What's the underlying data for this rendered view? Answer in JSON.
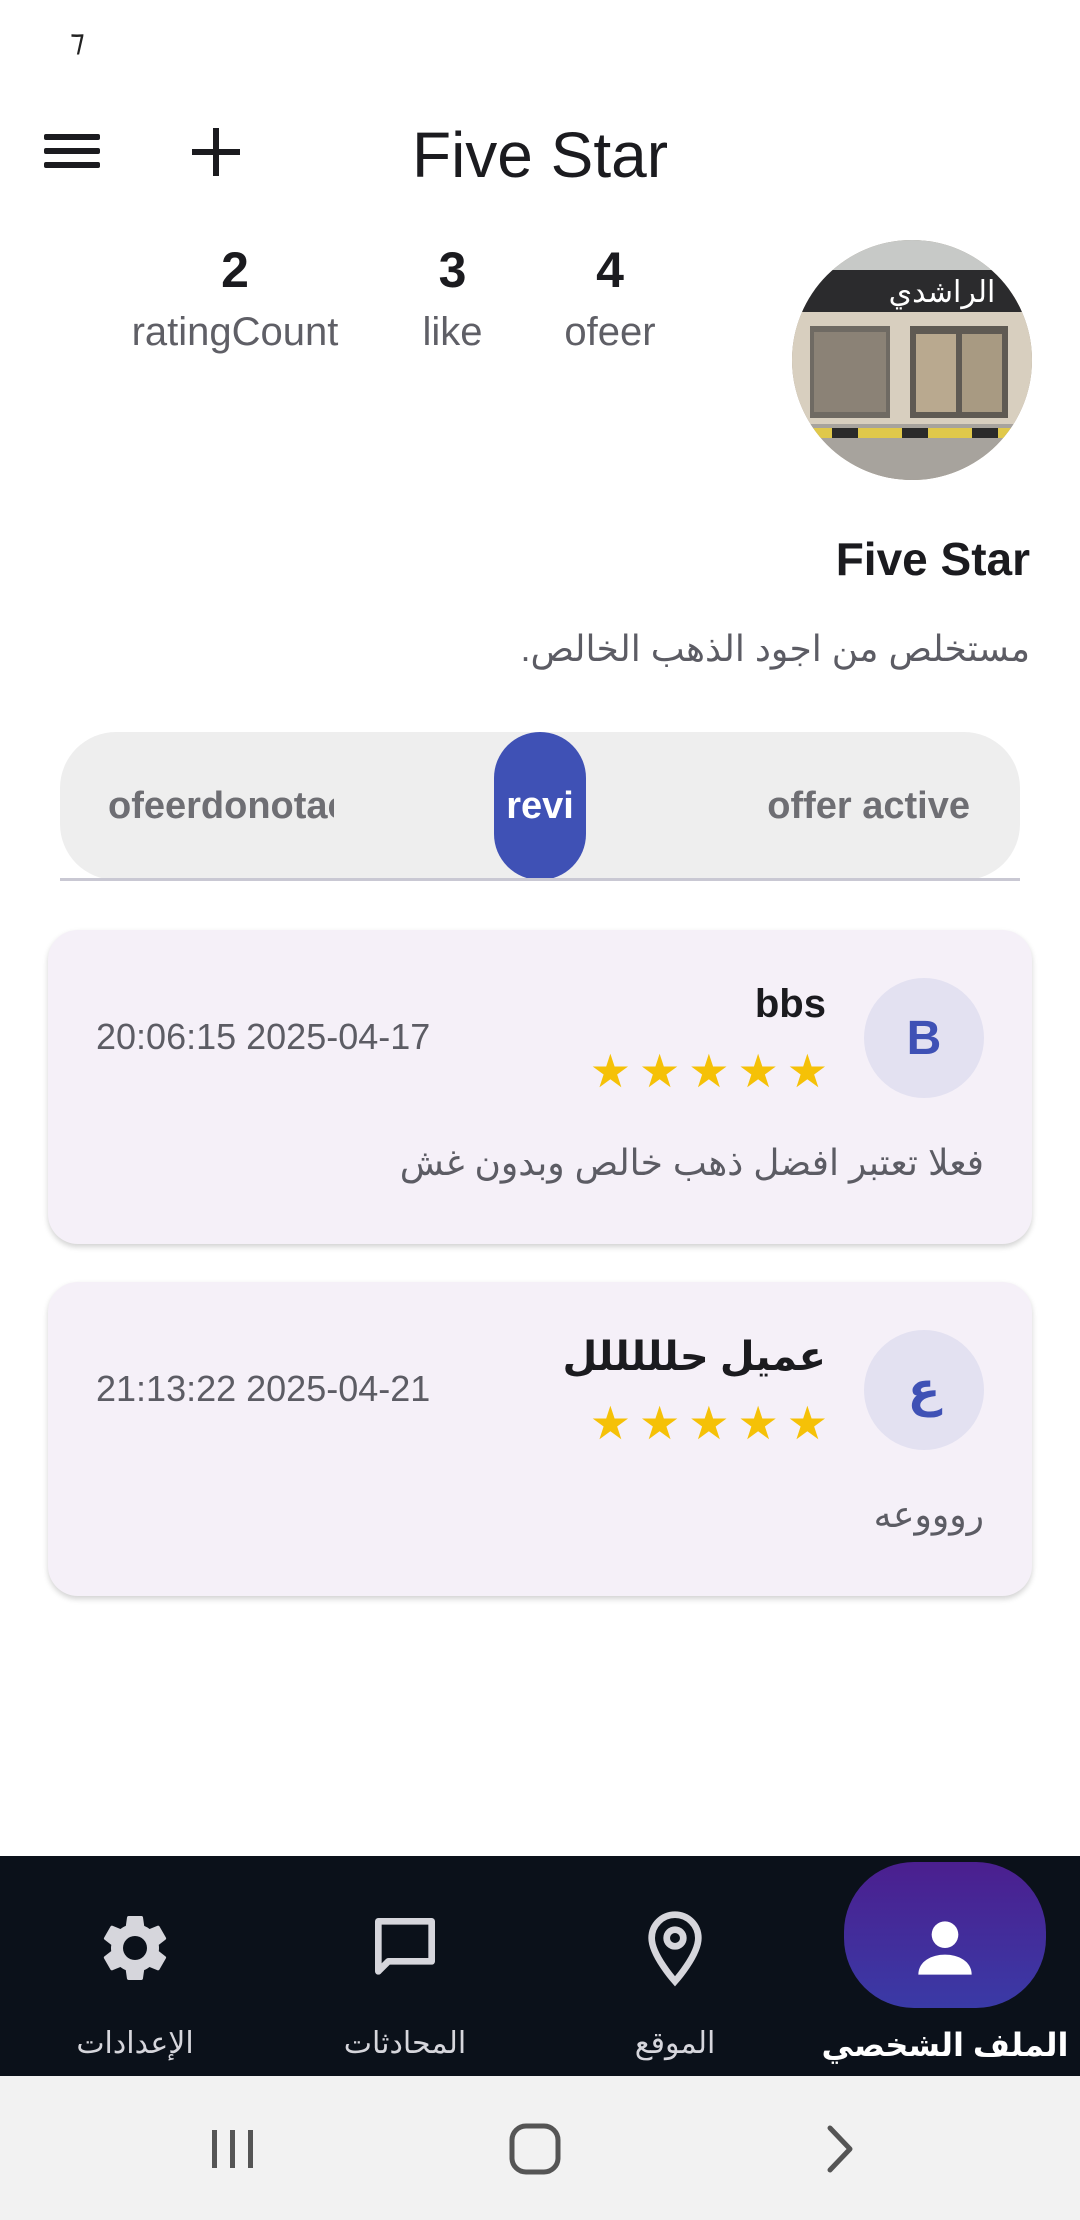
{
  "status_bar": {
    "glyph": "⁊"
  },
  "app_bar": {
    "title": "Five Star",
    "menu_icon": "hamburger-menu-icon",
    "add_icon": "plus-icon"
  },
  "stats": [
    {
      "value": "2",
      "label": "ratingCount"
    },
    {
      "value": "3",
      "label": "like"
    },
    {
      "value": "4",
      "label": "ofeer"
    }
  ],
  "profile": {
    "name": "Five Star",
    "description": "مستخلص من اجود الذهب الخالص."
  },
  "tabs": {
    "left": "ofeerdonotactive",
    "active": "revi",
    "right": "offer active"
  },
  "reviews": [
    {
      "initial": "B",
      "name": "bbs",
      "date": "20:06:15 2025-04-17",
      "stars": 5,
      "text": "فعلا تعتبر افضل ذهب خالص وبدون غش"
    },
    {
      "initial": "ع",
      "name": "عميل حلللللل",
      "date": "21:13:22 2025-04-21",
      "stars": 5,
      "text": "روووعه"
    }
  ],
  "bottom_nav": {
    "settings": "الإعدادات",
    "chats": "المحادثات",
    "location": "الموقع",
    "profile": "الملف الشخصي",
    "active": "profile"
  },
  "colors": {
    "accent": "#3f51b5",
    "star": "#f5c107",
    "card_bg": "#f5f0f8",
    "nav_bg": "#0b111a"
  }
}
